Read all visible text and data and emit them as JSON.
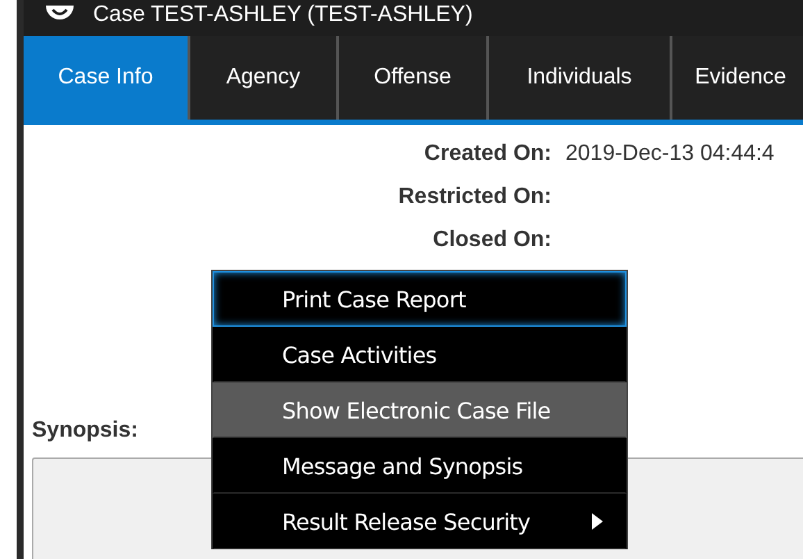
{
  "window": {
    "title": "Case TEST-ASHLEY (TEST-ASHLEY)"
  },
  "tabs": [
    {
      "label": "Case Info",
      "selected": true
    },
    {
      "label": "Agency",
      "selected": false
    },
    {
      "label": "Offense",
      "selected": false
    },
    {
      "label": "Individuals",
      "selected": false
    },
    {
      "label": "Evidence",
      "selected": false
    }
  ],
  "fields": [
    {
      "label": "Created On:",
      "value": "2019-Dec-13 04:44:4"
    },
    {
      "label": "Restricted On:"
    },
    {
      "label": "Closed On:"
    }
  ],
  "synopsis": {
    "label": "Synopsis:"
  },
  "context_menu": {
    "items": [
      {
        "label": "Print Case Report",
        "focused": true,
        "highlighted": false,
        "has_submenu": false
      },
      {
        "label": "Case Activities",
        "focused": false,
        "highlighted": false,
        "has_submenu": false
      },
      {
        "label": "Show Electronic Case File",
        "focused": false,
        "highlighted": true,
        "has_submenu": false
      },
      {
        "label": "Message and Synopsis",
        "focused": false,
        "highlighted": false,
        "has_submenu": false
      },
      {
        "label": "Result Release Security",
        "focused": false,
        "highlighted": false,
        "has_submenu": true
      }
    ]
  }
}
